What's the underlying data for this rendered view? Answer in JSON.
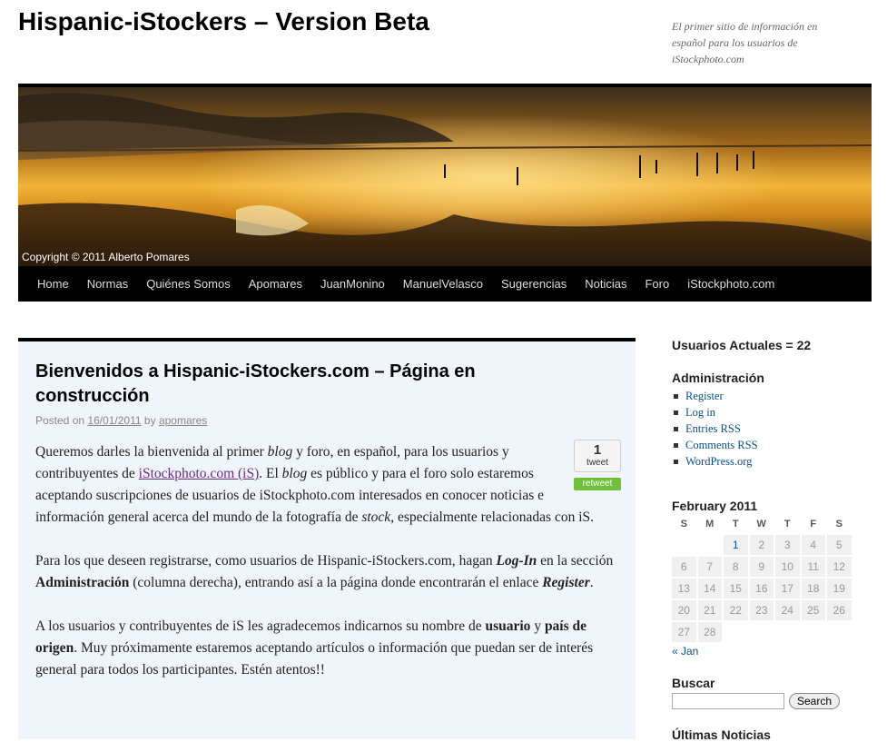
{
  "site": {
    "title": "Hispanic-iStockers – Version Beta",
    "tagline": "El primer sitio de información en español para los usuarios de iStockphoto.com",
    "banner_copyright": "Copyright © 2011 Alberto Pomares"
  },
  "nav": [
    "Home",
    "Normas",
    "Quiénes Somos",
    "Apomares",
    "JuanMonino",
    "ManuelVelasco",
    "Sugerencias",
    "Noticias",
    "Foro",
    "iStockphoto.com"
  ],
  "post": {
    "title": "Bienvenidos a Hispanic-iStockers.com – Página en construcción",
    "meta_prefix": "Posted on",
    "date": "16/01/2011",
    "meta_by": "by",
    "author": "apomares",
    "tweet_count": "1",
    "tweet_label": "tweet",
    "retweet_label": "retweet",
    "p1": {
      "a": "Queremos darles la bienvenida al primer ",
      "b": "blog",
      "c": " y foro, en español, para los usuarios y contribuyentes de ",
      "link": "iStockphoto.com (iS)",
      "d": ". El ",
      "e": "blog",
      "f": " es público y para el foro solo estaremos aceptando suscripciones de usuarios de iStockphoto.com interesados en conocer noticias e información general acerca del mundo de la fotografía de ",
      "g": "stock,",
      "h": " especialmente relacionadas con iS."
    },
    "p2": {
      "a": "Para los que deseen registrarse, como usuarios de Hispanic-iStockers.com, hagan ",
      "b": "Log-In",
      "c": " en la sección ",
      "d": "Administración",
      "e": " (columna derecha), entrando así a la página  donde encontrarán el enlace ",
      "f": "Register",
      "g": "."
    },
    "p3": {
      "a": "A los usuarios y contribuyentes de iS les agradecemos indicarnos su nombre de ",
      "b": "usuario",
      "c": " y ",
      "d": "país de origen",
      "e": ". Muy próximamente estaremos aceptando artículos o información que puedan ser de interés general para todos los participantes. Estén atentos!!"
    }
  },
  "sidebar": {
    "users_title": "Usuarios Actuales = 22",
    "admin_title": "Administración",
    "admin_links": [
      "Register",
      "Log in",
      "Entries RSS",
      "Comments RSS",
      "WordPress.org"
    ],
    "calendar": {
      "caption": "February 2011",
      "weekdays": [
        "S",
        "M",
        "T",
        "W",
        "T",
        "F",
        "S"
      ],
      "weeks": [
        [
          "",
          "",
          "1",
          "2",
          "3",
          "4",
          "5"
        ],
        [
          "6",
          "7",
          "8",
          "9",
          "10",
          "11",
          "12"
        ],
        [
          "13",
          "14",
          "15",
          "16",
          "17",
          "18",
          "19"
        ],
        [
          "20",
          "21",
          "22",
          "23",
          "24",
          "25",
          "26"
        ],
        [
          "27",
          "28",
          "",
          "",
          "",
          "",
          ""
        ]
      ],
      "linked_day": "1",
      "prev_link": "« Jan"
    },
    "search_title": "Buscar",
    "search_button": "Search",
    "next_title": "Últimas Noticias"
  }
}
